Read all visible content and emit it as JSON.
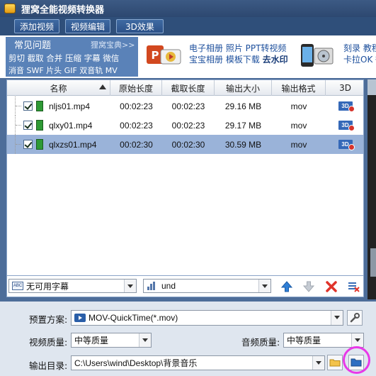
{
  "app": {
    "title": "狸窝全能视频转换器"
  },
  "toolbar": {
    "add_video": "添加视频",
    "edit_video": "视频编辑",
    "effect_3d": "3D效果"
  },
  "faq": {
    "title": "常见问题",
    "more": "狸窝宝典>>",
    "row1": "剪切 截取 合并 压缩 字幕 微信",
    "row2": "消音 SWF 片头 GIF 双音轨 MV"
  },
  "promo": {
    "line1": "电子相册 照片 PPT转视频",
    "line2a": "宝宝相册 模板下载 ",
    "line2b": "去水印",
    "right1": "刻录 教程",
    "right2": "卡拉OK 微"
  },
  "table": {
    "headers": {
      "name": "名称",
      "orig_len": "原始长度",
      "cut_len": "截取长度",
      "out_size": "输出大小",
      "out_fmt": "输出格式",
      "col3d": "3D"
    },
    "rows": [
      {
        "name": "nljs01.mp4",
        "orig": "00:02:23",
        "cut": "00:02:23",
        "size": "29.16 MB",
        "fmt": "mov",
        "checked": true
      },
      {
        "name": "qlxy01.mp4",
        "orig": "00:02:23",
        "cut": "00:02:23",
        "size": "29.17 MB",
        "fmt": "mov",
        "checked": true
      },
      {
        "name": "qlxzs01.mp4",
        "orig": "00:02:30",
        "cut": "00:02:30",
        "size": "30.59 MB",
        "fmt": "mov",
        "checked": true,
        "selected": true
      }
    ],
    "badge_3d": "3D"
  },
  "subtitle_select": {
    "value": "无可用字幕",
    "icon": "subtitle-icon"
  },
  "audio_select": {
    "value": "und",
    "icon": "audio-track-icon"
  },
  "settings": {
    "preset_label": "预置方案:",
    "preset_value": "MOV-QuickTime(*.mov)",
    "video_quality_label": "视频质量:",
    "video_quality_value": "中等质量",
    "audio_quality_label": "音频质量:",
    "audio_quality_value": "中等质量",
    "output_dir_label": "输出目录:",
    "output_dir_value": "C:\\Users\\wind\\Desktop\\背景音乐"
  },
  "colors": {
    "accent": "#4d6d99",
    "selected_row": "#9ab3d9",
    "highlight_ring": "#e838e8"
  }
}
